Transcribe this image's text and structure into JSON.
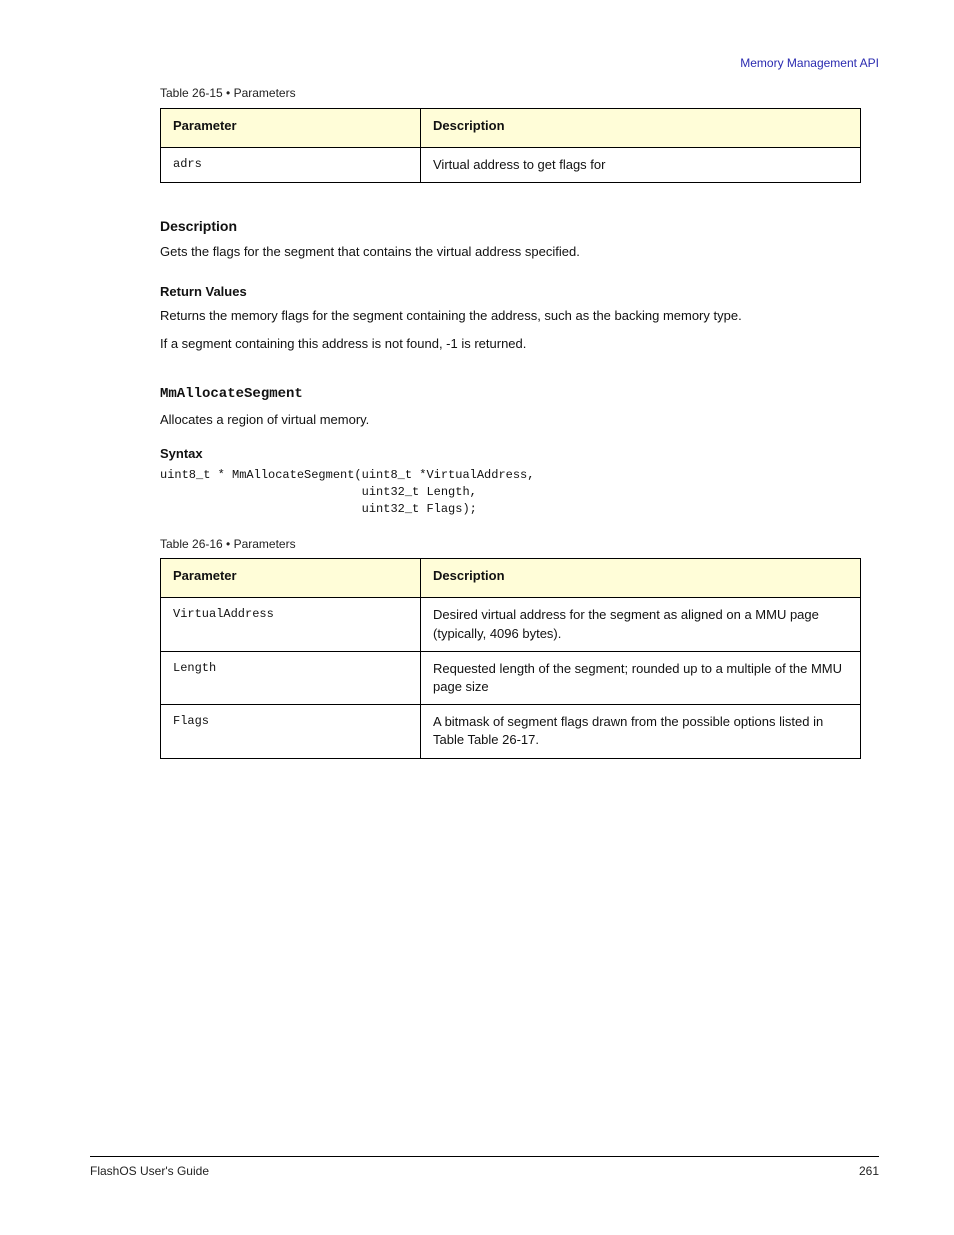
{
  "header": {
    "link": "Memory Management API"
  },
  "table1": {
    "caption": "Table 26-15 •  Parameters",
    "cols": [
      "Parameter",
      "Description"
    ],
    "rows": [
      {
        "param": "adrs",
        "desc": "Virtual address to get flags for"
      }
    ]
  },
  "section_desc": {
    "title": "Description",
    "p1": "Gets the flags for the segment that contains the virtual address specified.",
    "return_title": "Return Values",
    "p2": "Returns the memory flags for the segment containing the address, such as the backing memory type.",
    "p3": "If a segment containing this address is not found, -1 is returned."
  },
  "fn": {
    "name": "MmAllocateSegment",
    "summary": "Allocates a region of virtual memory.",
    "syntax_label": "Syntax",
    "signature": "uint8_t * MmAllocateSegment(uint8_t *VirtualAddress,\n                            uint32_t Length,\n                            uint32_t Flags);"
  },
  "table2": {
    "caption": "Table 26-16 •  Parameters",
    "cols": [
      "Parameter",
      "Description"
    ],
    "rows": [
      {
        "param": "VirtualAddress",
        "desc": "Desired virtual address for the segment as aligned on a MMU page (typically, 4096 bytes)."
      },
      {
        "param": "Length",
        "desc": "Requested length of the segment; rounded up to a multiple of the MMU page size"
      },
      {
        "param": "Flags",
        "desc": "A bitmask of segment flags drawn from the possible options listed in Table Table 26-17."
      }
    ]
  },
  "footer": {
    "left": "FlashOS User's Guide",
    "right": "261"
  }
}
